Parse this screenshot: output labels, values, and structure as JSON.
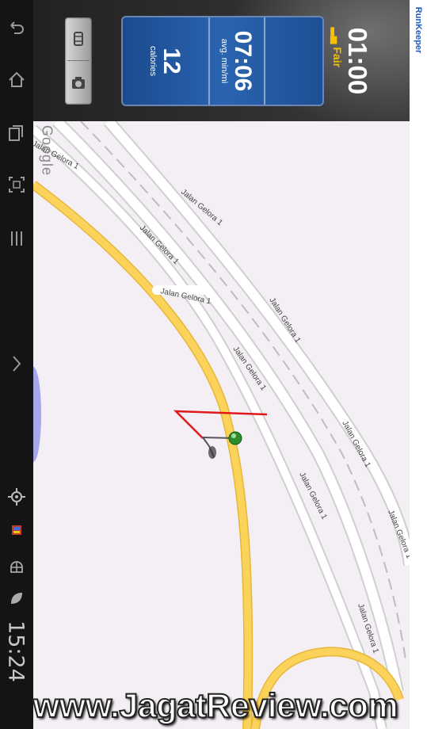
{
  "app": {
    "brand": "RunKeeper"
  },
  "timer": {
    "time": "01:00",
    "gps_signal": "Fair"
  },
  "stats": [
    {
      "value": "07:06",
      "label": "avg. min/mi"
    },
    {
      "value": "12",
      "label": "calories"
    }
  ],
  "camera_tools": {
    "top_icon": "screen-rotate-icon",
    "bottom_icon": "camera-icon"
  },
  "map": {
    "attribution": "Google",
    "road_name": "Jalan Gelora 1",
    "colors": {
      "background": "#f4eff4",
      "main_road": "#fbd25a",
      "street": "#ffffff",
      "route": "#e01a1a",
      "marker": "#2e8b2e"
    }
  },
  "system_bar": {
    "clock": "15:24",
    "icons": [
      "back-icon",
      "home-icon",
      "recent-apps-icon",
      "screenshot-icon",
      "menu-icon",
      "expand-arrow-icon",
      "gps-icon",
      "notification-app-icon",
      "android-icon",
      "leaf-icon"
    ]
  },
  "watermark": "www.JagatReview.com"
}
